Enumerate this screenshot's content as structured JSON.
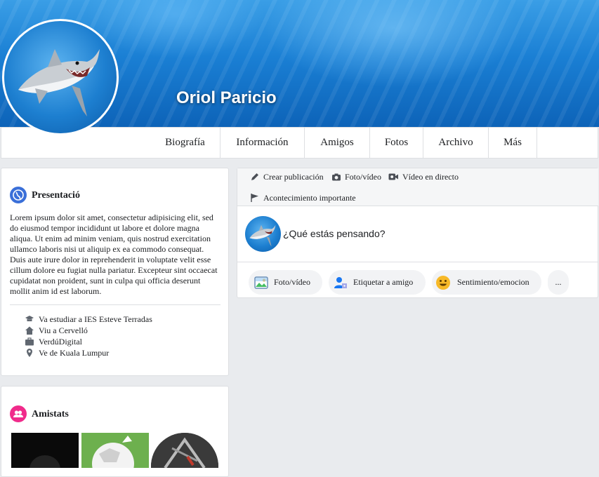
{
  "profile": {
    "name": "Oriol Paricio"
  },
  "nav": {
    "tabs": [
      "Biografía",
      "Información",
      "Amigos",
      "Fotos",
      "Archivo",
      "Más"
    ]
  },
  "presentation": {
    "title": "Presentació",
    "bio": "Lorem ipsum dolor sit amet, consectetur adipisicing elit, sed do eiusmod tempor incididunt ut labore et dolore magna aliqua. Ut enim ad minim veniam, quis nostrud exercitation ullamco laboris nisi ut aliquip ex ea commodo consequat. Duis aute irure dolor in reprehenderit in voluptate velit esse cillum dolore eu fugiat nulla pariatur. Excepteur sint occaecat cupidatat non proident, sunt in culpa qui officia deserunt mollit anim id est laborum.",
    "details": [
      {
        "icon": "graduation-cap-icon",
        "text": "Va estudiar a IES Esteve Terradas"
      },
      {
        "icon": "home-icon",
        "text": "Viu a Cervelló"
      },
      {
        "icon": "briefcase-icon",
        "text": "VerdúDigital"
      },
      {
        "icon": "location-pin-icon",
        "text": "Ve de Kuala Lumpur"
      }
    ]
  },
  "friends": {
    "title": "Amistats"
  },
  "composer": {
    "tabs": [
      {
        "icon": "pencil-icon",
        "label": "Crear publicación"
      },
      {
        "icon": "camera-icon",
        "label": "Foto/vídeo"
      },
      {
        "icon": "video-camera-icon",
        "label": "Vídeo en directo"
      },
      {
        "icon": "flag-icon",
        "label": "Acontecimiento importante"
      }
    ],
    "prompt": "¿Qué estás pensando?",
    "actions": [
      {
        "icon": "photo-icon",
        "label": "Foto/vídeo"
      },
      {
        "icon": "tag-friend-icon",
        "label": "Etiquetar a amigo"
      },
      {
        "icon": "smiley-icon",
        "label": "Sentimiento/emocion"
      },
      {
        "icon": "more-icon",
        "label": "..."
      }
    ]
  },
  "colors": {
    "accent": "#3b5998",
    "presentation_icon": "#3a6fd8",
    "friends_icon": "#f02b8b",
    "page_bg": "#e9ebee"
  }
}
